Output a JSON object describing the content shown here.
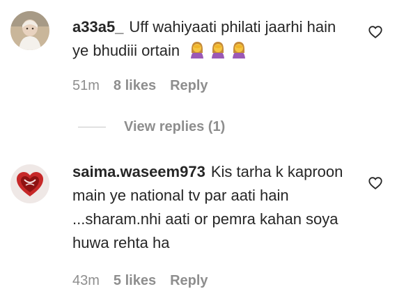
{
  "comments": [
    {
      "username": "a33a5_",
      "text": "Uff wahiyaati philati jaarhi hain ye bhudiii ortain",
      "emoji": [
        "woman-facepalming-icon",
        "woman-facepalming-icon",
        "woman-facepalming-icon"
      ],
      "time": "51m",
      "likes": "8 likes",
      "reply_label": "Reply"
    },
    {
      "username": "saima.waseem973",
      "text": "Kis tarha k kaproon main ye national tv par aati hain ...sharam.nhi aati or pemra kahan soya huwa rehta ha",
      "time": "43m",
      "likes": "5 likes",
      "reply_label": "Reply"
    }
  ],
  "view_replies": "View replies (1)"
}
